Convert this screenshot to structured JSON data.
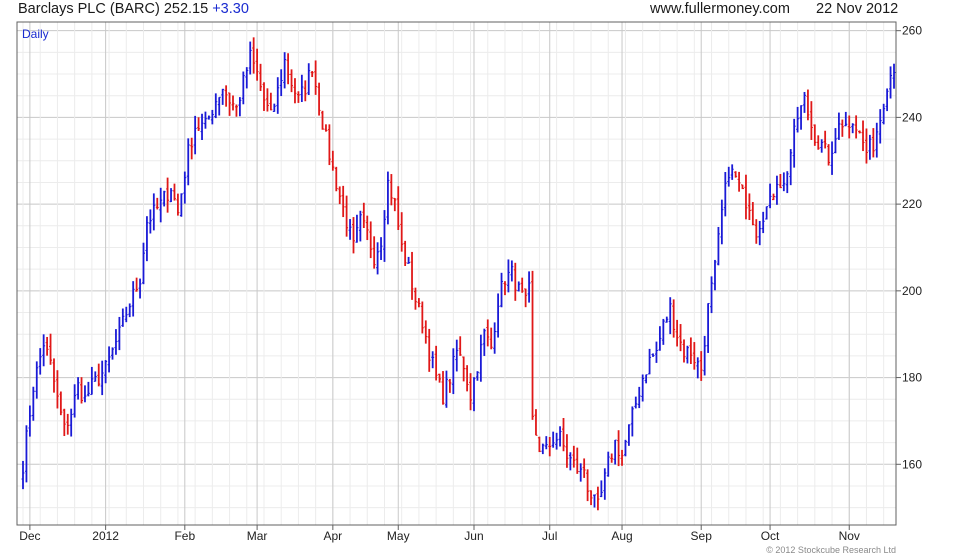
{
  "header": {
    "title": "Barclays PLC (BARC) 252.15",
    "change": "+3.30",
    "website": "www.fullermoney.com",
    "date": "22 Nov 2012"
  },
  "copyright": "© 2012 Stockcube Research Ltd",
  "colors": {
    "up": "#1a1ad6",
    "down": "#e01818",
    "grid": "#dcdcdc",
    "frame": "#606060",
    "label_accent": "#1a2bd0"
  },
  "chart_data": {
    "type": "candlestick",
    "period_label": "Daily",
    "ylim": [
      146,
      262
    ],
    "y_ticks": [
      160,
      180,
      200,
      220,
      240,
      260
    ],
    "x_ticks": [
      {
        "label": "Dec",
        "day": 2
      },
      {
        "label": "2012",
        "day": 24
      },
      {
        "label": "Feb",
        "day": 47
      },
      {
        "label": "Mar",
        "day": 68
      },
      {
        "label": "Apr",
        "day": 90
      },
      {
        "label": "May",
        "day": 109
      },
      {
        "label": "Jun",
        "day": 131
      },
      {
        "label": "Jul",
        "day": 153
      },
      {
        "label": "Aug",
        "day": 174
      },
      {
        "label": "Sep",
        "day": 197
      },
      {
        "label": "Oct",
        "day": 217
      },
      {
        "label": "Nov",
        "day": 240
      }
    ],
    "price_path": [
      [
        0,
        160
      ],
      [
        3,
        178
      ],
      [
        6,
        188
      ],
      [
        8,
        183
      ],
      [
        10,
        175
      ],
      [
        12,
        168
      ],
      [
        14,
        172
      ],
      [
        16,
        178
      ],
      [
        18,
        175
      ],
      [
        20,
        178
      ],
      [
        24,
        182
      ],
      [
        26,
        186
      ],
      [
        28,
        190
      ],
      [
        30,
        195
      ],
      [
        32,
        199
      ],
      [
        34,
        203
      ],
      [
        36,
        216
      ],
      [
        40,
        220
      ],
      [
        43,
        224
      ],
      [
        45,
        218
      ],
      [
        48,
        232
      ],
      [
        50,
        238
      ],
      [
        53,
        238
      ],
      [
        56,
        244
      ],
      [
        58,
        247
      ],
      [
        60,
        244
      ],
      [
        62,
        242
      ],
      [
        64,
        248
      ],
      [
        66,
        254
      ],
      [
        68,
        250
      ],
      [
        70,
        244
      ],
      [
        72,
        240
      ],
      [
        74,
        246
      ],
      [
        76,
        253
      ],
      [
        78,
        248
      ],
      [
        80,
        244
      ],
      [
        82,
        247
      ],
      [
        84,
        252
      ],
      [
        86,
        243
      ],
      [
        88,
        235
      ],
      [
        90,
        228
      ],
      [
        92,
        222
      ],
      [
        94,
        216
      ],
      [
        96,
        210
      ],
      [
        98,
        216
      ],
      [
        100,
        213
      ],
      [
        102,
        208
      ],
      [
        104,
        212
      ],
      [
        106,
        225
      ],
      [
        108,
        220
      ],
      [
        110,
        210
      ],
      [
        112,
        205
      ],
      [
        114,
        198
      ],
      [
        116,
        193
      ],
      [
        118,
        186
      ],
      [
        120,
        180
      ],
      [
        122,
        176
      ],
      [
        124,
        180
      ],
      [
        126,
        186
      ],
      [
        128,
        183
      ],
      [
        130,
        176
      ],
      [
        132,
        183
      ],
      [
        134,
        190
      ],
      [
        136,
        187
      ],
      [
        138,
        198
      ],
      [
        140,
        203
      ],
      [
        142,
        204
      ],
      [
        144,
        200
      ],
      [
        146,
        197
      ],
      [
        147,
        200
      ],
      [
        148,
        170
      ],
      [
        150,
        164
      ],
      [
        152,
        163
      ],
      [
        154,
        166
      ],
      [
        156,
        166
      ],
      [
        158,
        162
      ],
      [
        160,
        160
      ],
      [
        162,
        158
      ],
      [
        163,
        159
      ],
      [
        164,
        155
      ],
      [
        166,
        151
      ],
      [
        167,
        150
      ],
      [
        168,
        153
      ],
      [
        170,
        160
      ],
      [
        172,
        165
      ],
      [
        174,
        162
      ],
      [
        176,
        168
      ],
      [
        178,
        174
      ],
      [
        180,
        180
      ],
      [
        182,
        184
      ],
      [
        184,
        186
      ],
      [
        186,
        192
      ],
      [
        188,
        196
      ],
      [
        190,
        190
      ],
      [
        192,
        186
      ],
      [
        194,
        186
      ],
      [
        196,
        183
      ],
      [
        197,
        182
      ],
      [
        199,
        196
      ],
      [
        201,
        205
      ],
      [
        203,
        218
      ],
      [
        205,
        228
      ],
      [
        207,
        226
      ],
      [
        209,
        222
      ],
      [
        211,
        220
      ],
      [
        213,
        214
      ],
      [
        215,
        218
      ],
      [
        217,
        220
      ],
      [
        219,
        226
      ],
      [
        221,
        224
      ],
      [
        223,
        232
      ],
      [
        225,
        240
      ],
      [
        227,
        244
      ],
      [
        229,
        238
      ],
      [
        231,
        234
      ],
      [
        233,
        232
      ],
      [
        235,
        230
      ],
      [
        237,
        240
      ],
      [
        239,
        238
      ],
      [
        241,
        240
      ],
      [
        243,
        236
      ],
      [
        245,
        232
      ],
      [
        247,
        234
      ],
      [
        249,
        240
      ],
      [
        251,
        248
      ],
      [
        253,
        252
      ]
    ],
    "n_days": 254
  }
}
